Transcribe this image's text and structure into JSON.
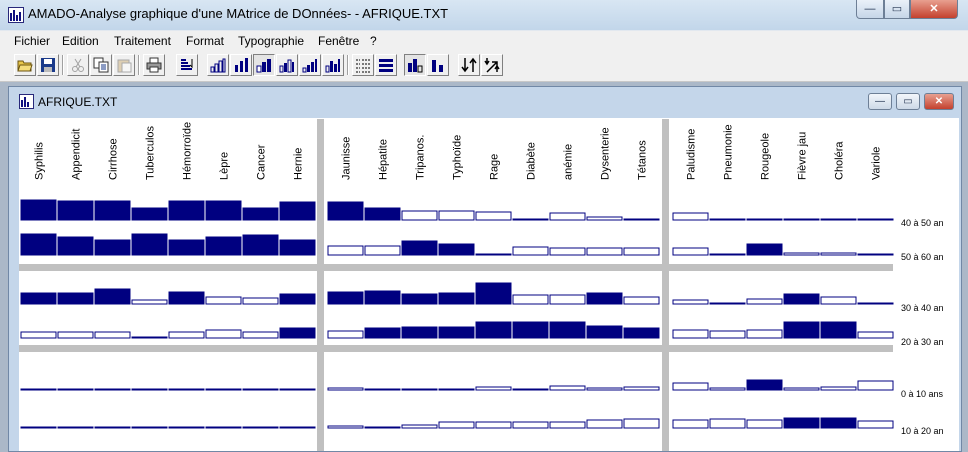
{
  "window": {
    "title": "AMADO-Analyse graphique d'une MAtrice de DOnnées- - AFRIQUE.TXT",
    "controls": {
      "minimize": "—",
      "maximize": "▭",
      "close": "✕"
    }
  },
  "menu": [
    "Fichier",
    "Edition",
    "Traitement",
    "Format",
    "Typographie",
    "Fenêtre",
    "?"
  ],
  "document": {
    "title": "AFRIQUE.TXT",
    "controls": {
      "minimize": "—",
      "maximize": "▭",
      "close": "✕"
    }
  },
  "colors": {
    "fill": "#000080",
    "separator": "#c0c0c0",
    "empty": "#ffffff"
  },
  "matrix": {
    "columns": [
      [
        "Syphilis",
        "Appendicit",
        "Cirrhose",
        "Tuberculos",
        "Hémorroïde",
        "Lèpre",
        "Cancer",
        "Hernie"
      ],
      [
        "Jaunisse",
        "Hépatite",
        "Tripanos.",
        "Typhoïde",
        "Rage",
        "Diabète",
        "anémie",
        "Dysenterie",
        "Tétanos"
      ],
      [
        "Paludisme",
        "Pneumonie",
        "Rougeole",
        "Fièvre jau",
        "Choléra",
        "Variole"
      ]
    ],
    "rows": [
      [
        "40 à 50 an",
        "50 à 60 an"
      ],
      [
        "30 à 40 an",
        "20 à 30 an"
      ],
      [
        "0 à 10 ans",
        "10 à 20 an"
      ]
    ],
    "cells": [
      [
        0.9,
        0.88,
        0.86,
        0.56,
        0.86,
        0.88,
        0.56,
        0.8,
        0.8,
        0.56,
        0.4,
        0.4,
        0.36,
        0.04,
        0.3,
        0.12,
        0.06,
        0.32,
        0.0,
        0.06,
        0.04,
        0.04,
        0.0
      ],
      [
        0.95,
        0.8,
        0.68,
        0.96,
        0.7,
        0.82,
        0.9,
        0.68,
        0.4,
        0.4,
        0.62,
        0.52,
        0.06,
        0.38,
        0.32,
        0.32,
        0.32,
        0.3,
        0.06,
        0.5,
        0.08,
        0.08,
        0.0
      ],
      [
        0.5,
        0.52,
        0.68,
        0.18,
        0.55,
        0.34,
        0.28,
        0.45,
        0.55,
        0.58,
        0.46,
        0.49,
        0.94,
        0.43,
        0.43,
        0.49,
        0.34,
        0.2,
        0.0,
        0.22,
        0.47,
        0.34,
        0.0
      ],
      [
        0.25,
        0.25,
        0.25,
        0.0,
        0.27,
        0.38,
        0.25,
        0.46,
        0.3,
        0.46,
        0.52,
        0.52,
        0.72,
        0.72,
        0.72,
        0.56,
        0.45,
        0.36,
        0.31,
        0.38,
        0.73,
        0.73,
        0.25
      ],
      [
        0.04,
        0.0,
        0.0,
        0.04,
        0.0,
        0.0,
        0.04,
        0.0,
        0.08,
        0.04,
        0.0,
        0.0,
        0.14,
        0.04,
        0.18,
        0.08,
        0.14,
        0.34,
        0.08,
        0.45,
        0.08,
        0.14,
        0.4
      ],
      [
        0.0,
        0.05,
        0.05,
        0.05,
        0.05,
        0.05,
        0.05,
        0.05,
        0.1,
        0.05,
        0.15,
        0.25,
        0.25,
        0.28,
        0.28,
        0.36,
        0.4,
        0.35,
        0.4,
        0.38,
        0.45,
        0.45,
        0.3
      ]
    ]
  }
}
